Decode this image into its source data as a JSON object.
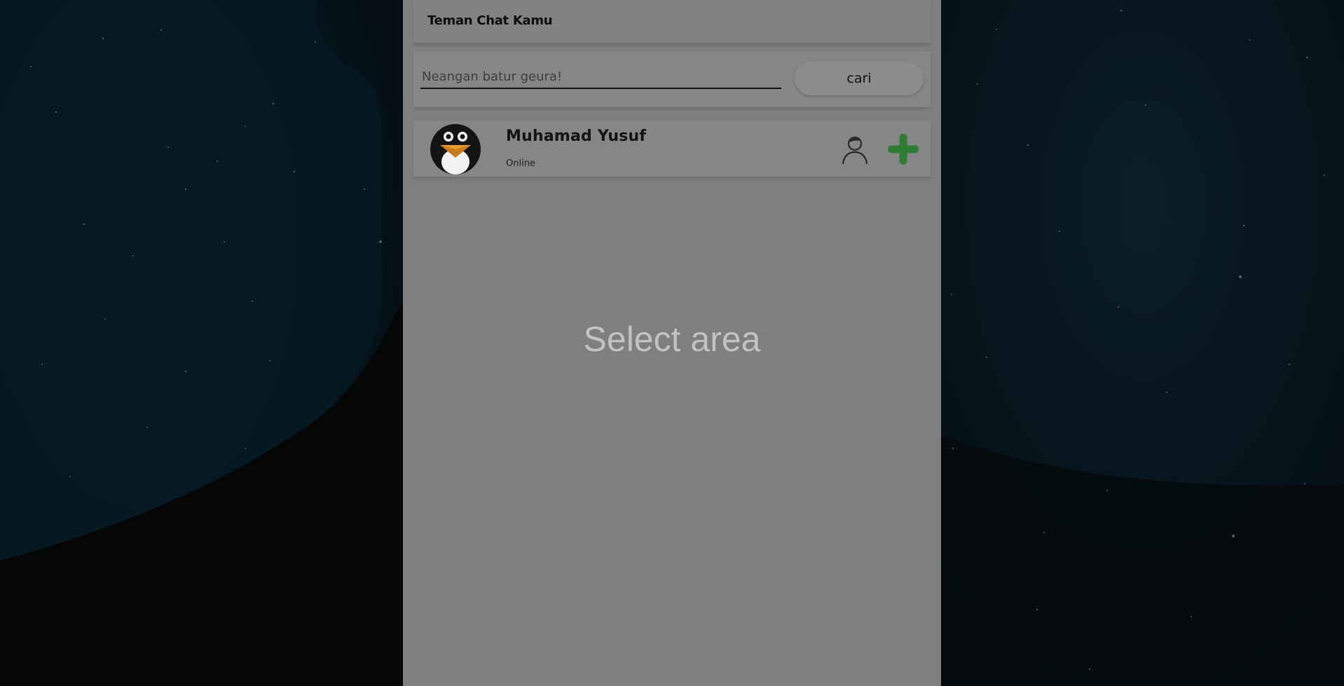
{
  "header": {
    "title": "Teman Chat Kamu"
  },
  "search": {
    "placeholder": "Neangan batur geura!",
    "value": "",
    "button_label": "cari"
  },
  "contacts": [
    {
      "name": "Muhamad Yusuf",
      "status": "Online",
      "avatar_icon": "penguin-avatar",
      "actions": [
        "profile-icon",
        "add-icon"
      ]
    }
  ],
  "main": {
    "placeholder": "Select area"
  },
  "colors": {
    "background": "#030c10",
    "panel": "#7f7f7f",
    "card": "#868686",
    "add_accent": "#2e7d32",
    "placeholder_text": "#c2c2c2"
  }
}
